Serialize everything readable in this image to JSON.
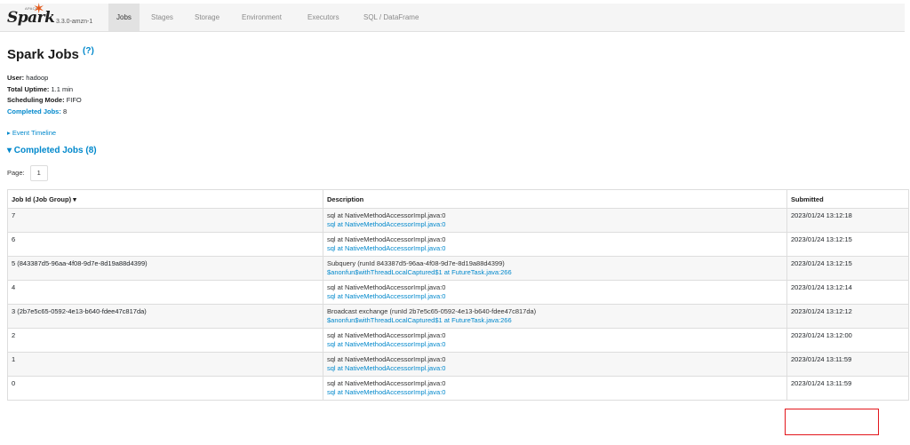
{
  "app": {
    "brand_small": "APACHE",
    "brand_name": "Spark",
    "version": "3.3.0-amzn-1",
    "brand_color": "#e25a1c",
    "accent_color": "#0088cc"
  },
  "nav": {
    "tabs": [
      {
        "label": "Jobs",
        "active": true
      },
      {
        "label": "Stages",
        "active": false
      },
      {
        "label": "Storage",
        "active": false
      },
      {
        "label": "Environment",
        "active": false
      },
      {
        "label": "Executors",
        "active": false
      },
      {
        "label": "SQL / DataFrame",
        "active": false
      }
    ]
  },
  "page": {
    "title": "Spark Jobs",
    "help": "(?)"
  },
  "summary": {
    "user_label": "User:",
    "user_value": "hadoop",
    "uptime_label": "Total Uptime:",
    "uptime_value": "1.1 min",
    "mode_label": "Scheduling Mode:",
    "mode_value": "FIFO",
    "completed_label": "Completed Jobs:",
    "completed_value": "8"
  },
  "event_timeline": "▸ Event Timeline",
  "completed_section": {
    "header": "▾ Completed Jobs (8)",
    "page_label": "Page:",
    "page_number": "1"
  },
  "table": {
    "headers": [
      "Job Id (Job Group) ▾",
      "Description",
      "Submitted"
    ],
    "rows": [
      {
        "job": "7",
        "desc": "sql at NativeMethodAccessorImpl.java:0",
        "link": "sql at NativeMethodAccessorImpl.java:0",
        "submitted": "2023/01/24 13:12:18"
      },
      {
        "job": "6",
        "desc": "sql at NativeMethodAccessorImpl.java:0",
        "link": "sql at NativeMethodAccessorImpl.java:0",
        "submitted": "2023/01/24 13:12:15"
      },
      {
        "job": "5 (843387d5-96aa-4f08-9d7e-8d19a88d4399)",
        "desc": "Subquery (runId 843387d5-96aa-4f08-9d7e-8d19a88d4399)",
        "link": "$anonfun$withThreadLocalCaptured$1 at FutureTask.java:266",
        "submitted": "2023/01/24 13:12:15"
      },
      {
        "job": "4",
        "desc": "sql at NativeMethodAccessorImpl.java:0",
        "link": "sql at NativeMethodAccessorImpl.java:0",
        "submitted": "2023/01/24 13:12:14"
      },
      {
        "job": "3 (2b7e5c65-0592-4e13-b640-fdee47c817da)",
        "desc": "Broadcast exchange (runId 2b7e5c65-0592-4e13-b640-fdee47c817da)",
        "link": "$anonfun$withThreadLocalCaptured$1 at FutureTask.java:266",
        "submitted": "2023/01/24 13:12:12"
      },
      {
        "job": "2",
        "desc": "sql at NativeMethodAccessorImpl.java:0",
        "link": "sql at NativeMethodAccessorImpl.java:0",
        "submitted": "2023/01/24 13:12:00"
      },
      {
        "job": "1",
        "desc": "sql at NativeMethodAccessorImpl.java:0",
        "link": "sql at NativeMethodAccessorImpl.java:0",
        "submitted": "2023/01/24 13:11:59"
      },
      {
        "job": "0",
        "desc": "sql at NativeMethodAccessorImpl.java:0",
        "link": "sql at NativeMethodAccessorImpl.java:0",
        "submitted": "2023/01/24 13:11:59"
      }
    ]
  },
  "annotation": {
    "highlight_color": "#e3161c"
  }
}
